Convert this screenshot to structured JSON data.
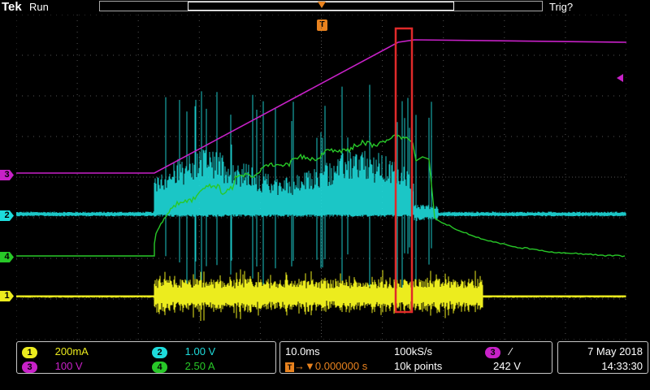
{
  "header": {
    "brand": "Tek",
    "run_state": "Run",
    "trigger_state": "Trig?",
    "trigger_marker_label": "T"
  },
  "colors": {
    "ch1": "#ecec1e",
    "ch2": "#1edcdc",
    "ch3": "#c821c8",
    "ch4": "#28c828",
    "highlight_box": "#e02a2a",
    "grid": "#555555",
    "trigger": "#e8821e"
  },
  "channels": [
    {
      "id": "1",
      "scale": "200mA"
    },
    {
      "id": "2",
      "scale": "1.00 V"
    },
    {
      "id": "3",
      "scale": "100 V"
    },
    {
      "id": "4",
      "scale": "2.50 A"
    }
  ],
  "timebase": {
    "time_per_div": "10.0ms",
    "sample_rate": "100kS/s",
    "trigger_delay": "0.000000 s",
    "record_length": "10k points"
  },
  "trigger": {
    "source": "3",
    "slope_icon": "rising-edge-icon",
    "slope_glyph": "∕",
    "level": "242 V"
  },
  "datetime": {
    "date": "7 May 2018",
    "time": "14:33:30"
  }
}
